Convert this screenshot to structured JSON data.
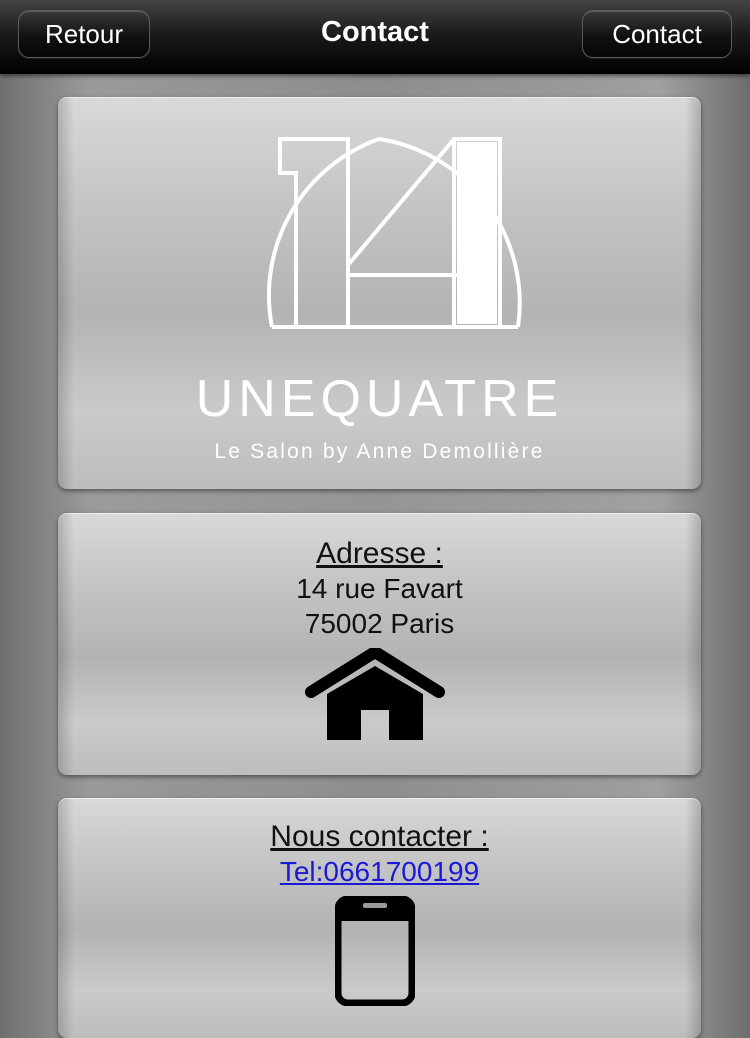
{
  "navbar": {
    "back_label": "Retour",
    "title": "Contact",
    "contact_label": "Contact"
  },
  "brand": {
    "logo_number": "14",
    "name": "UNEQUATRE",
    "tagline": "Le Salon by Anne Demollière"
  },
  "address": {
    "heading": "Adresse :",
    "line1": "14 rue Favart",
    "line2": "75002 Paris",
    "icon": "home-icon"
  },
  "contact": {
    "heading": "Nous contacter :",
    "phone": "Tel:0661700199",
    "icon": "smartphone-icon"
  },
  "colors": {
    "link": "#1a1ad6",
    "navbar": "#000000",
    "logo": "#ffffff"
  }
}
